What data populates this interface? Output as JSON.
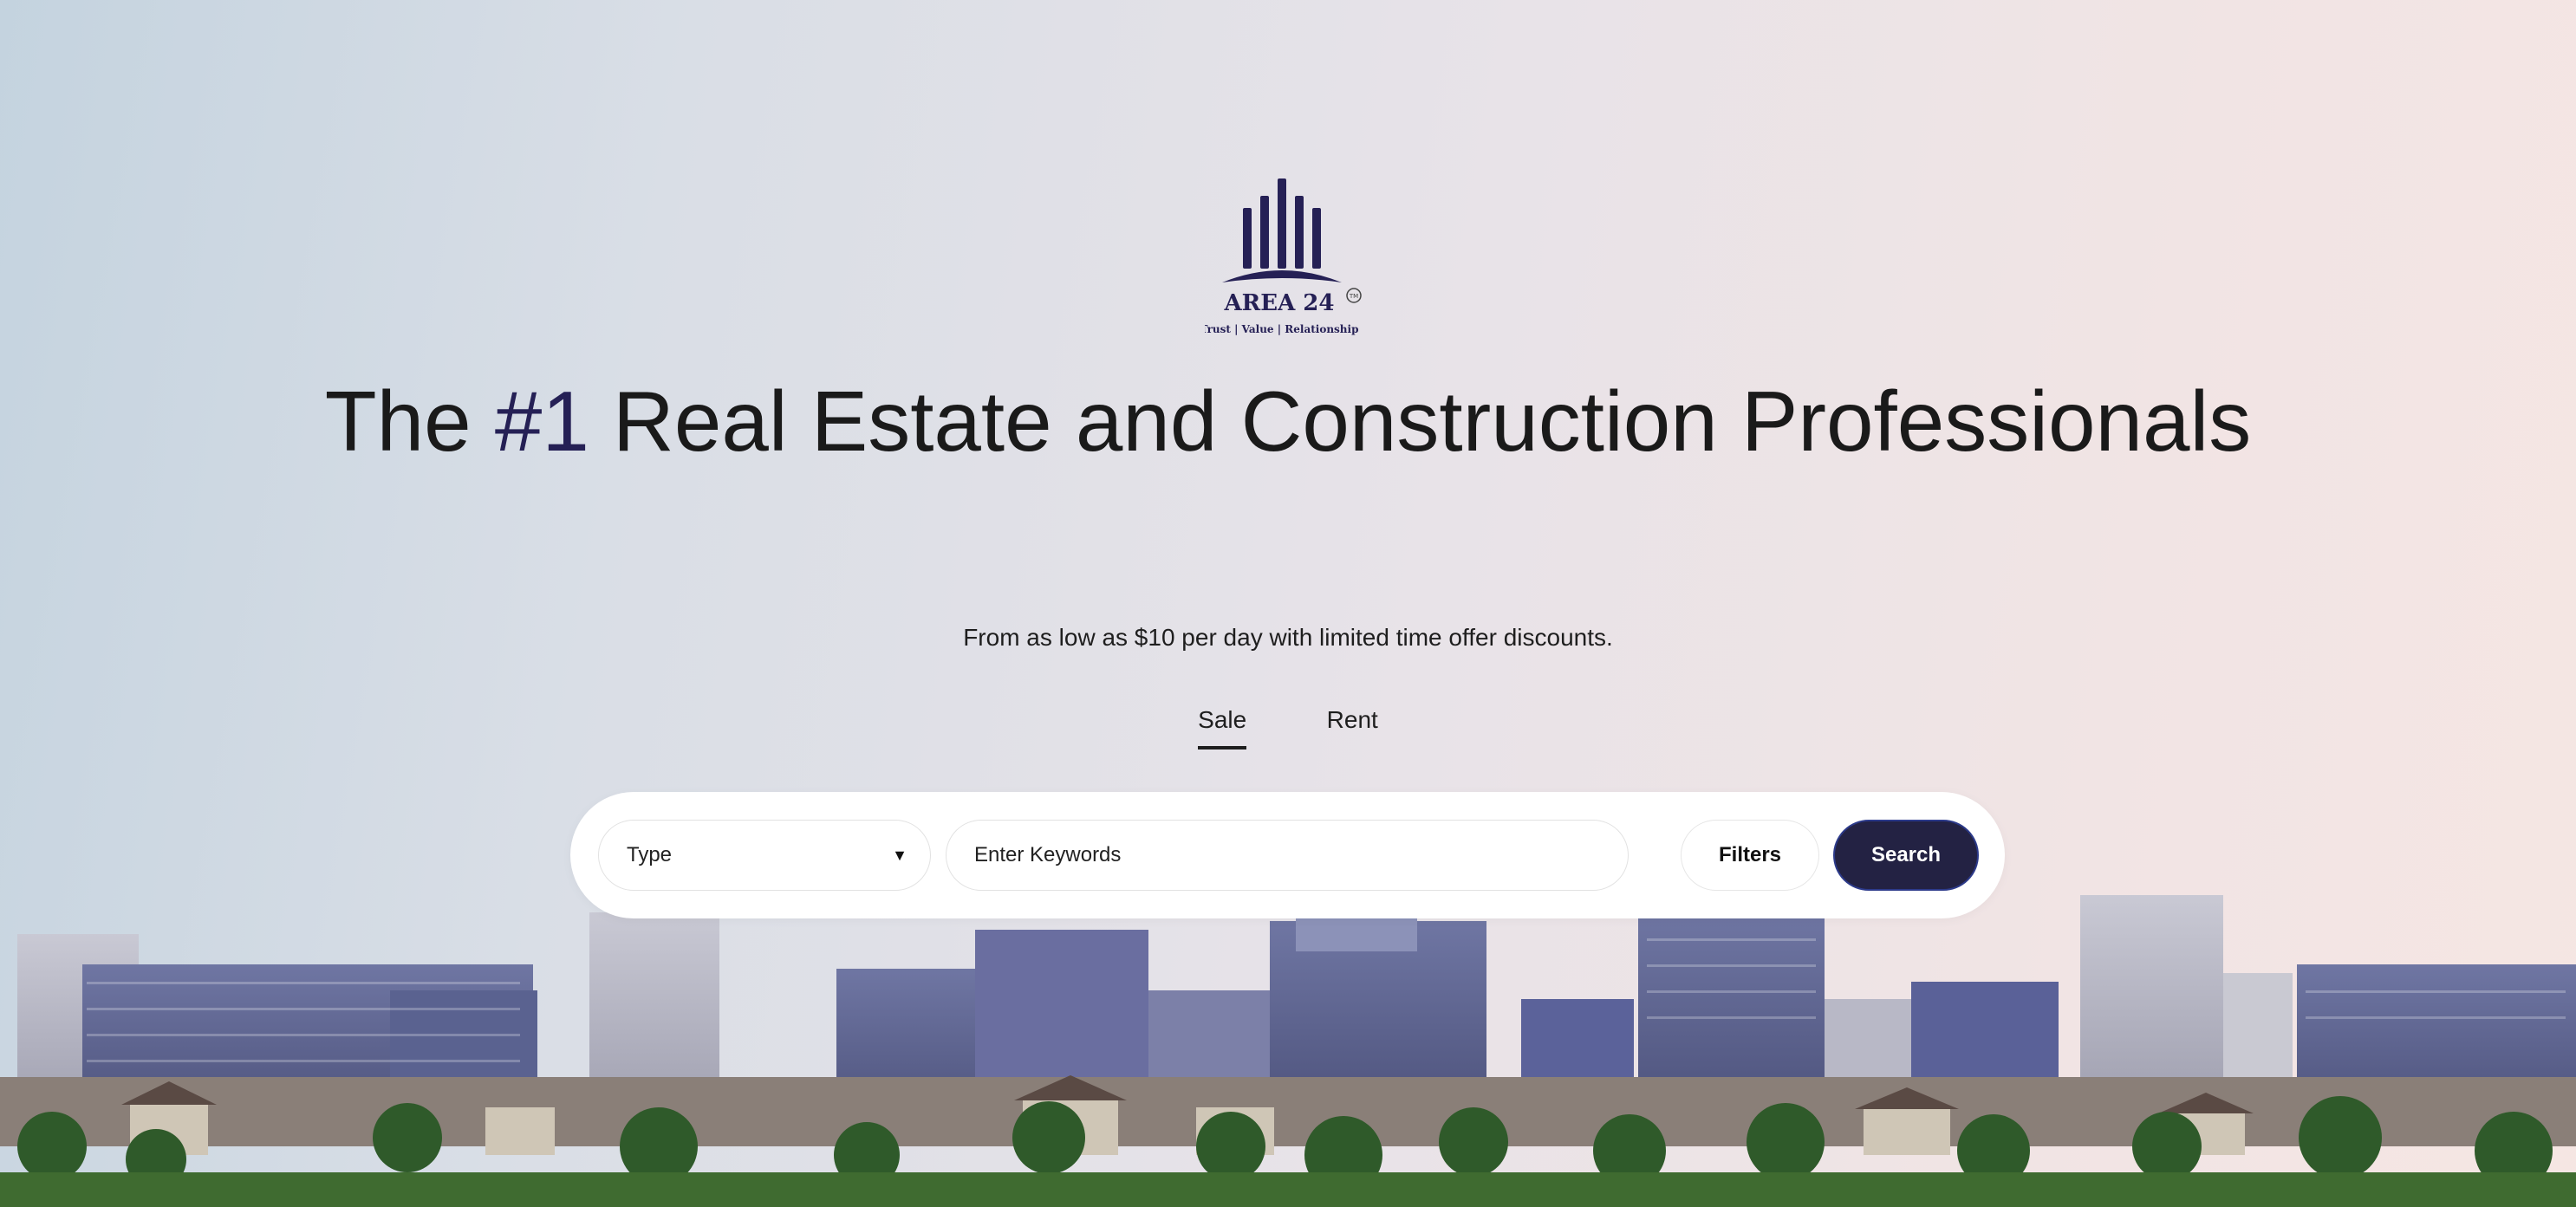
{
  "brand": {
    "name": "AREA 24",
    "tm": "TM",
    "tagline": "Trust | Value | Relationship",
    "color": "#252055"
  },
  "hero": {
    "title_prefix": "The ",
    "title_highlight": "#1",
    "title_suffix": " Real Estate and Construction Professionals",
    "subtitle": "From as low as $10 per day with limited time offer discounts."
  },
  "tabs": [
    {
      "label": "Sale",
      "active": true
    },
    {
      "label": "Rent",
      "active": false
    }
  ],
  "search": {
    "type_select": "Type",
    "keywords_placeholder": "Enter Keywords",
    "filters_label": "Filters",
    "search_label": "Search",
    "search_button_color": "#232243"
  }
}
